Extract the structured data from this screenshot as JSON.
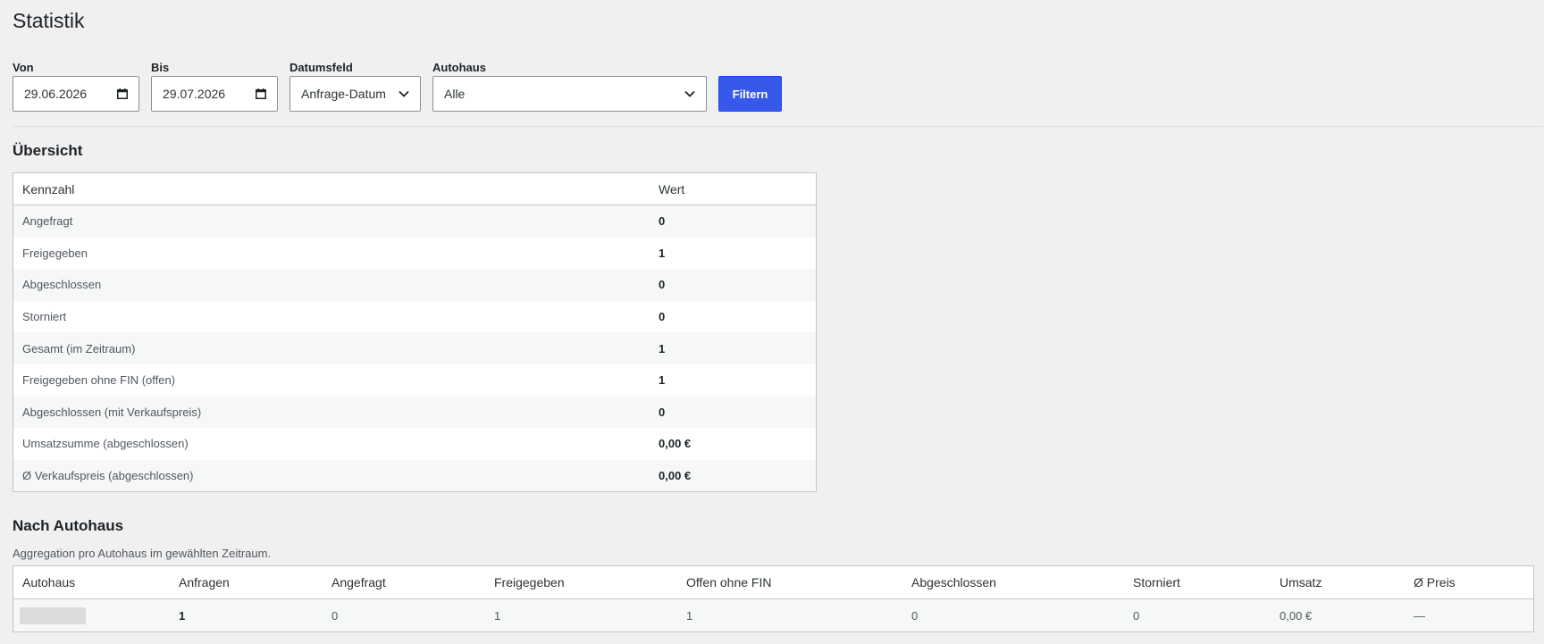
{
  "page": {
    "title": "Statistik"
  },
  "filters": {
    "from_label": "Von",
    "from_value": "29.06.2026",
    "to_label": "Bis",
    "to_value": "29.07.2026",
    "datefield_label": "Datumsfeld",
    "datefield_value": "Anfrage-Datum",
    "dealer_label": "Autohaus",
    "dealer_value": "Alle",
    "filter_button": "Filtern",
    "accent_color": "#3858e9"
  },
  "overview": {
    "title": "Übersicht",
    "columns": [
      "Kennzahl",
      "Wert"
    ],
    "rows": [
      {
        "label": "Angefragt",
        "value": "0"
      },
      {
        "label": "Freigegeben",
        "value": "1"
      },
      {
        "label": "Abgeschlossen",
        "value": "0"
      },
      {
        "label": "Storniert",
        "value": "0"
      },
      {
        "label": "Gesamt (im Zeitraum)",
        "value": "1"
      },
      {
        "label": "Freigegeben ohne FIN (offen)",
        "value": "1"
      },
      {
        "label": "Abgeschlossen (mit Verkaufspreis)",
        "value": "0"
      },
      {
        "label": "Umsatzsumme (abgeschlossen)",
        "value": "0,00 €"
      },
      {
        "label": "Ø Verkaufspreis (abgeschlossen)",
        "value": "0,00 €"
      }
    ]
  },
  "by_dealer": {
    "title": "Nach Autohaus",
    "description": "Aggregation pro Autohaus im gewählten Zeitraum.",
    "columns": [
      "Autohaus",
      "Anfragen",
      "Angefragt",
      "Freigegeben",
      "Offen ohne FIN",
      "Abgeschlossen",
      "Storniert",
      "Umsatz",
      "Ø Preis"
    ],
    "rows": [
      {
        "dealer": "",
        "requests": "1",
        "requested": "0",
        "approved": "1",
        "open_without_vin": "1",
        "completed": "0",
        "cancelled": "0",
        "revenue": "0,00 €",
        "avg_price": "—"
      }
    ]
  }
}
